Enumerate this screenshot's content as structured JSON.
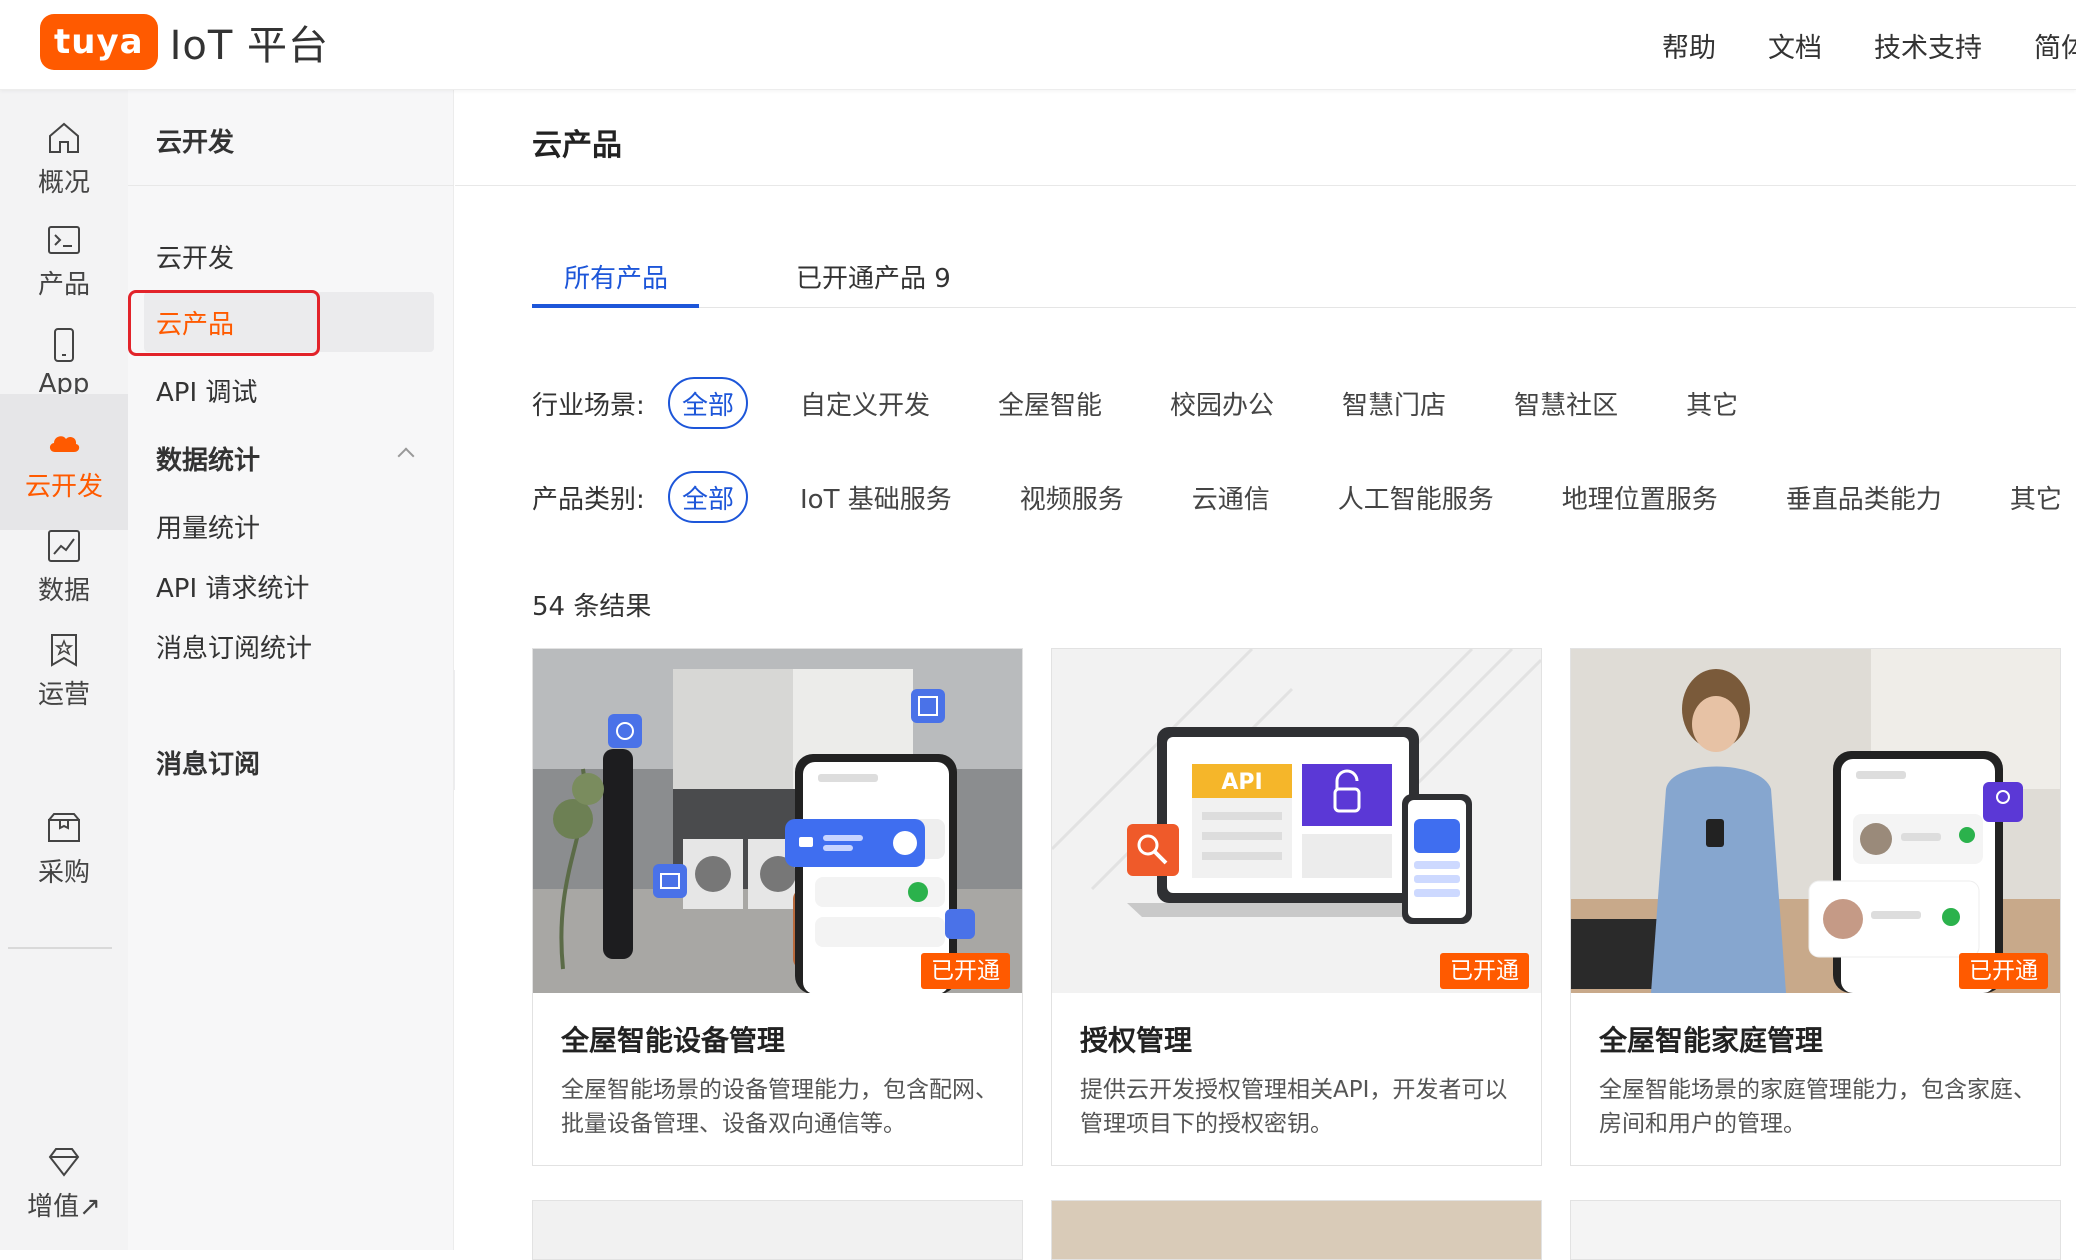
{
  "header": {
    "logo_badge": "tuya",
    "logo_text": "IoT 平台",
    "nav": [
      "帮助",
      "文档",
      "技术支持",
      "简体中文"
    ]
  },
  "rail": {
    "items": [
      {
        "label": "概况",
        "icon": "home-icon"
      },
      {
        "label": "产品",
        "icon": "terminal-icon"
      },
      {
        "label": "App",
        "icon": "phone-icon"
      },
      {
        "label": "云开发",
        "icon": "cloud-icon",
        "active": true
      },
      {
        "label": "数据",
        "icon": "chart-icon"
      },
      {
        "label": "运营",
        "icon": "bookmark-star-icon"
      },
      {
        "label": "采购",
        "icon": "box-icon"
      },
      {
        "label": "增值↗",
        "icon": "diamond-icon"
      }
    ]
  },
  "sidebar": {
    "title": "云开发",
    "items": [
      "云开发",
      "云产品",
      "API 调试",
      "数据统计",
      "用量统计",
      "API 请求统计",
      "消息订阅统计",
      "消息订阅"
    ]
  },
  "main": {
    "title": "云产品",
    "tabs": [
      "所有产品",
      "已开通产品 9"
    ],
    "industry_label": "行业场景:",
    "industry_options": [
      "全部",
      "自定义开发",
      "全屋智能",
      "校园办公",
      "智慧门店",
      "智慧社区",
      "其它"
    ],
    "category_label": "产品类别:",
    "category_options": [
      "全部",
      "IoT 基础服务",
      "视频服务",
      "云通信",
      "人工智能服务",
      "地理位置服务",
      "垂直品类能力",
      "其它"
    ],
    "result_count": "54 条结果",
    "cards": [
      {
        "title": "全屋智能设备管理",
        "desc": "全屋智能场景的设备管理能力，包含配网、批量设备管理、设备双向通信等。",
        "badge": "已开通"
      },
      {
        "title": "授权管理",
        "desc": "提供云开发授权管理相关API，开发者可以管理项目下的授权密钥。",
        "badge": "已开通",
        "api_label": "API"
      },
      {
        "title": "全屋智能家庭管理",
        "desc": "全屋智能场景的家庭管理能力，包含家庭、房间和用户的管理。",
        "badge": "已开通"
      }
    ]
  },
  "colors": {
    "brand": "#ff5a00",
    "accent": "#1d56d9",
    "highlight_box": "#e2232a"
  }
}
